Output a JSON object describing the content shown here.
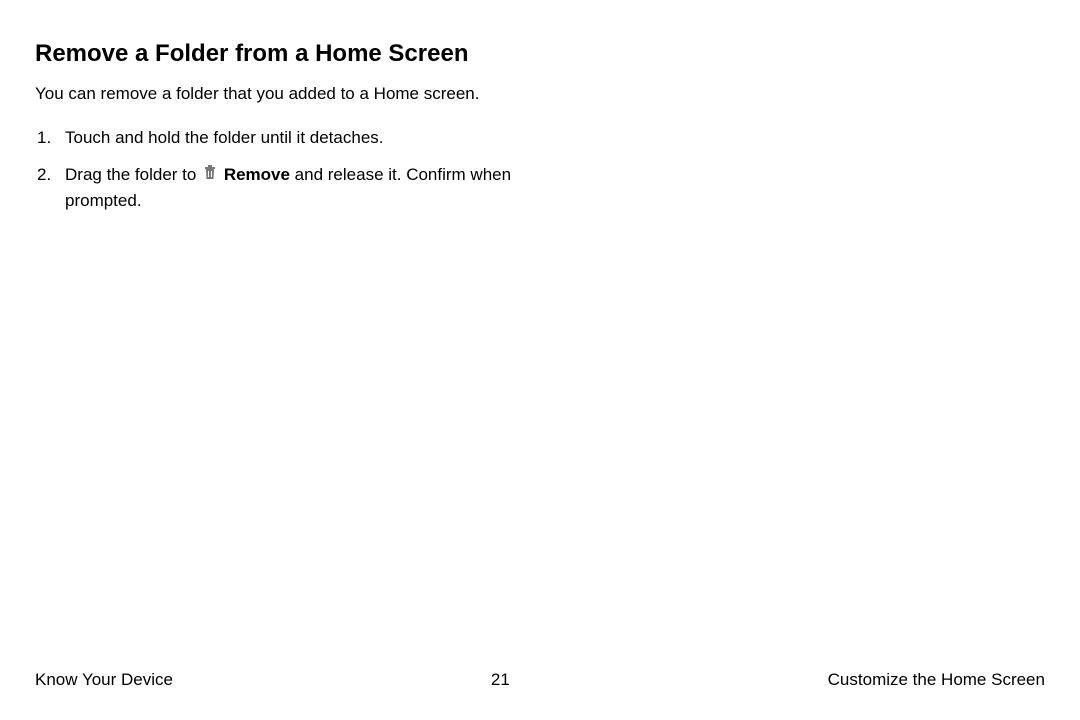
{
  "heading": "Remove a Folder from a Home Screen",
  "description": "You can remove a folder that you added to a Home screen.",
  "steps": {
    "item1": "Touch and hold the folder until it detaches.",
    "item2_prefix": "Drag the folder to ",
    "item2_bold": "Remove",
    "item2_suffix": " and release it. Confirm when prompted."
  },
  "footer": {
    "left": "Know Your Device",
    "page": "21",
    "right": "Customize the Home Screen"
  }
}
